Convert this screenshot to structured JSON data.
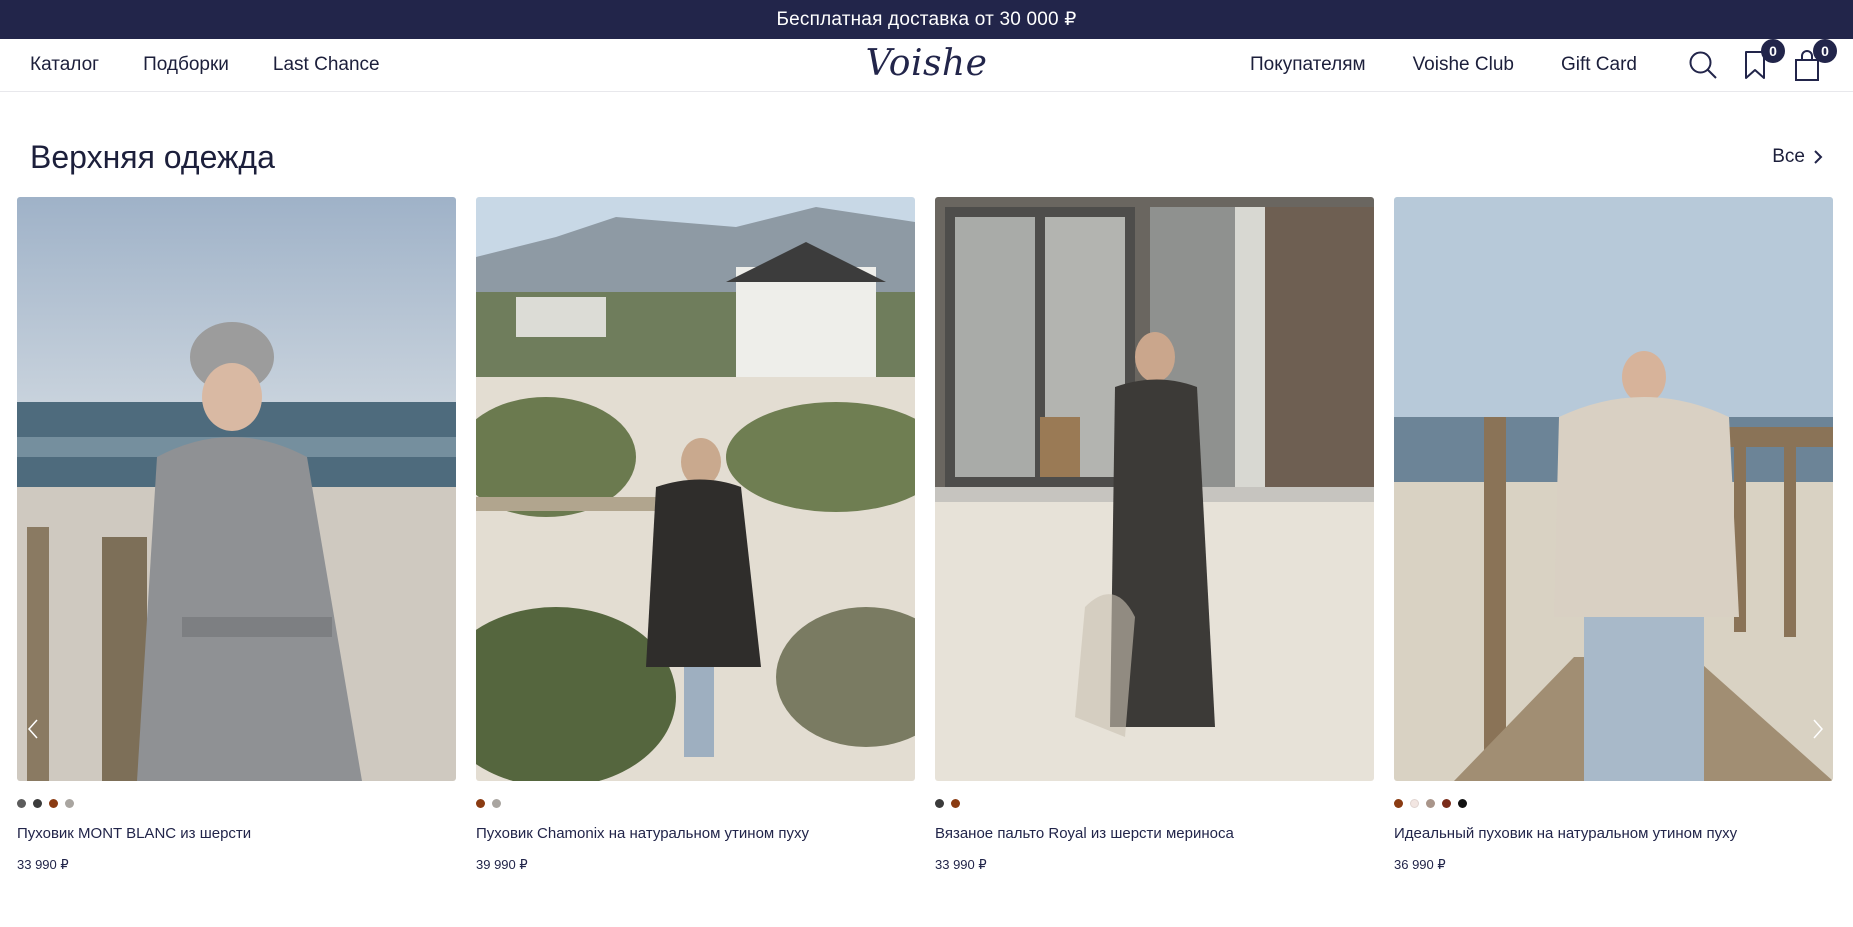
{
  "promo": {
    "text": "Бесплатная доставка от 30 000 ₽"
  },
  "header": {
    "logo": "Voishe",
    "nav_left": [
      "Каталог",
      "Подборки",
      "Last Chance"
    ],
    "nav_right": [
      "Покупателям",
      "Voishe Club",
      "Gift Card"
    ],
    "favorites_count": "0",
    "cart_count": "0"
  },
  "section": {
    "title": "Верхняя одежда",
    "see_all": "Все"
  },
  "products": [
    {
      "name": "Пуховик MONT BLANC из шерсти",
      "price": "33 990 ₽",
      "swatches": [
        "#5c5c5c",
        "#3b3b3b",
        "#8a3b12",
        "#a9a5a0"
      ]
    },
    {
      "name": "Пуховик Chamonix на натуральном утином пуху",
      "price": "39 990 ₽",
      "swatches": [
        "#8a3b12",
        "#a9a5a0"
      ]
    },
    {
      "name": "Вязаное пальто Royal из шерсти мериноса",
      "price": "33 990 ₽",
      "swatches": [
        "#3b3b3b",
        "#8a3b12"
      ]
    },
    {
      "name": "Идеальный пуховик на натуральном утином пуху",
      "price": "36 990 ₽",
      "swatches": [
        "#8a3b12",
        "#f2e6e2",
        "#a9958a",
        "#7a2c1a",
        "#111111"
      ]
    }
  ],
  "colors": {
    "accent": "#22254a"
  }
}
